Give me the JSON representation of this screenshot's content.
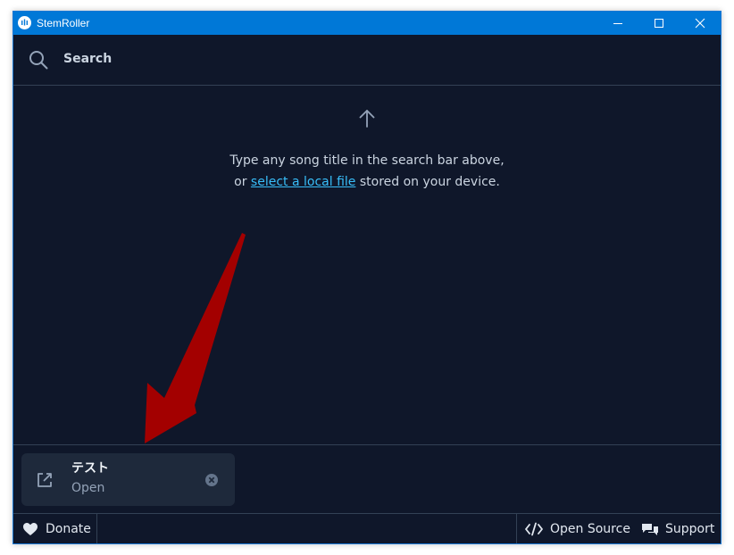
{
  "window": {
    "title": "StemRoller",
    "accent_color": "#0078d7",
    "background_color": "#0f172a"
  },
  "search": {
    "placeholder": "Search",
    "value": ""
  },
  "empty_state": {
    "line1": "Type any song title in the search bar above,",
    "line2_prefix": "or ",
    "link_text": "select a local file",
    "line2_suffix": " stored on your device.",
    "link_color": "#38bdf8"
  },
  "queue": {
    "items": [
      {
        "title": "テスト",
        "status": "Open",
        "icon": "external-link-icon",
        "remove_icon": "close-circle-icon"
      }
    ]
  },
  "footer": {
    "donate_label": "Donate",
    "open_source_label": "Open Source",
    "support_label": "Support"
  },
  "annotation": {
    "arrow_color": "#a30000"
  }
}
